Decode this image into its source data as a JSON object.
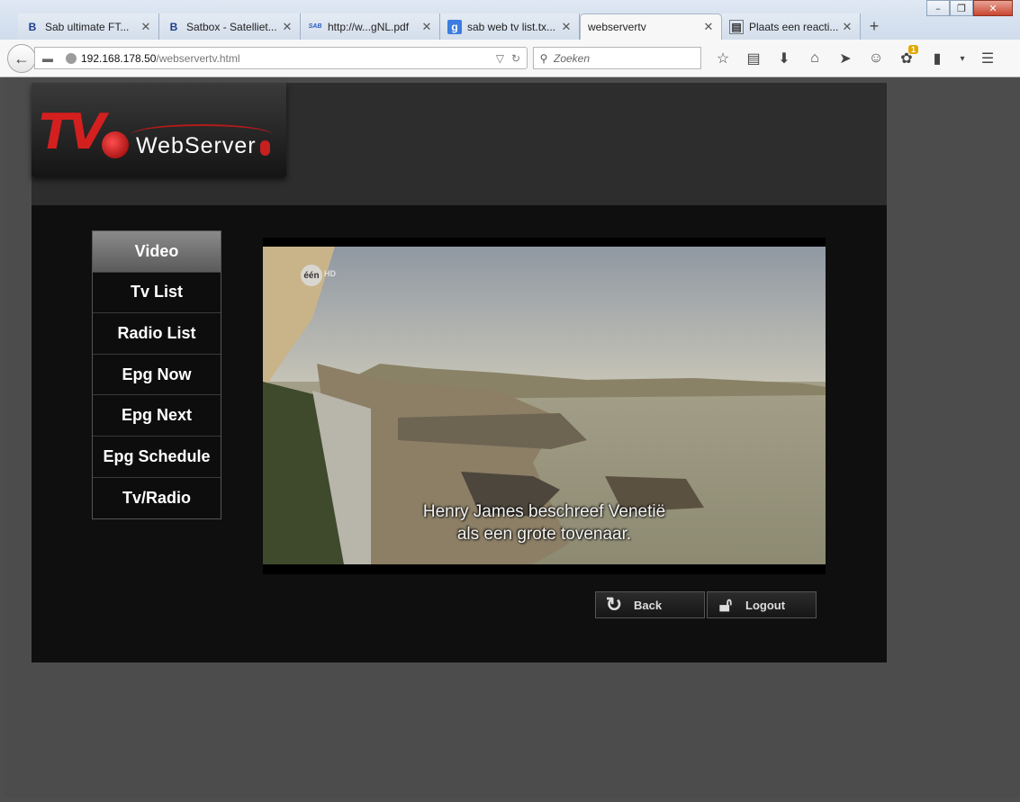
{
  "browser": {
    "tabs": [
      {
        "icon": "sab-favicon-icon",
        "glyph": "B",
        "label": "Sab ultimate FT...",
        "active": false
      },
      {
        "icon": "sab-favicon-icon",
        "glyph": "B",
        "label": "Satbox - Satelliet...",
        "active": false
      },
      {
        "icon": "pdf-favicon-icon",
        "glyph": "SAB",
        "label": "http://w...gNL.pdf",
        "active": false
      },
      {
        "icon": "google-favicon-icon",
        "glyph": "g",
        "label": "sab web tv list.tx...",
        "active": false
      },
      {
        "icon": "",
        "glyph": "",
        "label": "webservertv",
        "active": true
      },
      {
        "icon": "document-favicon-icon",
        "glyph": "▤",
        "label": "Plaats een reacti...",
        "active": false
      }
    ],
    "new_tab_label": "+",
    "url_host": "192.168.178.50",
    "url_path": "/webservertv.html",
    "search_placeholder": "Zoeken",
    "notification_badge": "1",
    "window_controls": [
      "–",
      "❐",
      "✕"
    ]
  },
  "site": {
    "logo": {
      "tv_text": "TV",
      "webserver_text": "WebServer"
    },
    "menu": [
      {
        "label": "Video",
        "active": true
      },
      {
        "label": "Tv List",
        "active": false
      },
      {
        "label": "Radio List",
        "active": false
      },
      {
        "label": "Epg Now",
        "active": false
      },
      {
        "label": "Epg Next",
        "active": false
      },
      {
        "label": "Epg Schedule",
        "active": false
      },
      {
        "label": "Tv/Radio",
        "active": false
      }
    ],
    "video": {
      "channel_logo": "één",
      "channel_hd": "HD",
      "subtitle_line1": "Henry James beschreef Venetië",
      "subtitle_line2": "als een grote tovenaar."
    },
    "buttons": {
      "back_label": "Back",
      "logout_label": "Logout"
    }
  }
}
